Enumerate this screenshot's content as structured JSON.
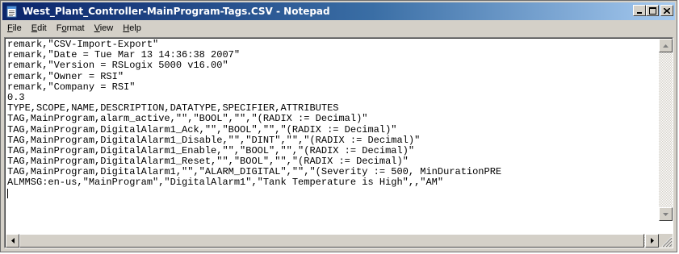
{
  "window": {
    "title": "West_Plant_Controller-MainProgram-Tags.CSV - Notepad",
    "minimize_icon": "minimize-icon",
    "maximize_icon": "maximize-icon",
    "close_icon": "close-icon"
  },
  "menu": [
    {
      "label": "File",
      "mnemonic": "F",
      "rest": "ile"
    },
    {
      "label": "Edit",
      "mnemonic": "E",
      "rest": "dit"
    },
    {
      "label": "Format",
      "mnemonic": "o",
      "before": "F",
      "rest": "rmat"
    },
    {
      "label": "View",
      "mnemonic": "V",
      "rest": "iew"
    },
    {
      "label": "Help",
      "mnemonic": "H",
      "rest": "elp"
    }
  ],
  "document": {
    "lines": [
      "remark,\"CSV-Import-Export\"",
      "remark,\"Date = Tue Mar 13 14:36:38 2007\"",
      "remark,\"Version = RSLogix 5000 v16.00\"",
      "remark,\"Owner = RSI\"",
      "remark,\"Company = RSI\"",
      "0.3",
      "TYPE,SCOPE,NAME,DESCRIPTION,DATATYPE,SPECIFIER,ATTRIBUTES",
      "TAG,MainProgram,alarm_active,\"\",\"BOOL\",\"\",\"(RADIX := Decimal)\"",
      "TAG,MainProgram,DigitalAlarm1_Ack,\"\",\"BOOL\",\"\",\"(RADIX := Decimal)\"",
      "TAG,MainProgram,DigitalAlarm1_Disable,\"\",\"DINT\",\"\",\"(RADIX := Decimal)\"",
      "TAG,MainProgram,DigitalAlarm1_Enable,\"\",\"BOOL\",\"\",\"(RADIX := Decimal)\"",
      "TAG,MainProgram,DigitalAlarm1_Reset,\"\",\"BOOL\",\"\",\"(RADIX := Decimal)\"",
      "TAG,MainProgram,DigitalAlarm1,\"\",\"ALARM_DIGITAL\",\"\",\"(Severity := 500, MinDurationPRE",
      "ALMMSG:en-us,\"MainProgram\",\"DigitalAlarm1\",\"Tank Temperature is High\",,\"AM\""
    ]
  }
}
